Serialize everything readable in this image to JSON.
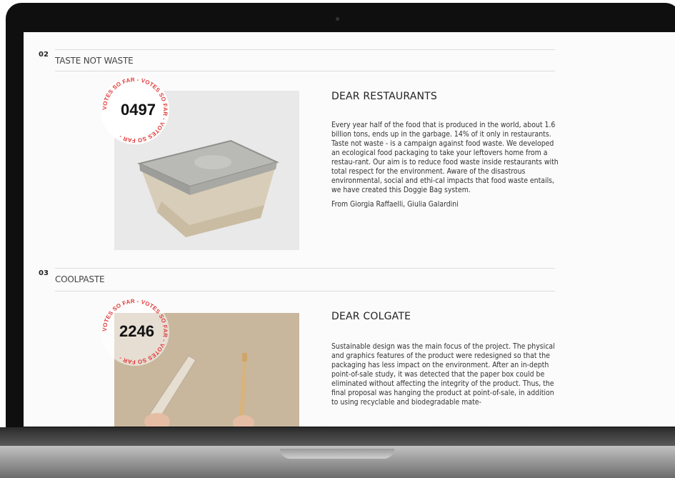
{
  "entries": [
    {
      "number": "02",
      "title": "TASTE NOT WASTE",
      "votes": "0497",
      "badge_text": "VOTES SO FAR - VOTES SO FAR - VOTES SO FAR - ",
      "heading": "DEAR RESTAURANTS",
      "paragraphs": [
        "Every year half of the food that is produced in the world, about 1.6 billion tons, ends up in the garbage. 14% of it only in restaurants. Taste not waste - is a campaign against food waste. We developed an ecological food packaging to take your leftovers home from a restau-rant. Our aim is to reduce food waste inside restaurants with total respect for the environment. Aware of the disastrous environmental, social and ethi-cal impacts that food waste entails, we have created this Doggie Bag system.",
        "From Giorgia Raffaelli, Giulia Galardini"
      ]
    },
    {
      "number": "03",
      "title": "COOLPASTE",
      "votes": "2246",
      "badge_text": "VOTES SO FAR - VOTES SO FAR - VOTES SO FAR - ",
      "heading": "DEAR COLGATE",
      "paragraphs": [
        "Sustainable design was the main focus of the project. The physical and graphics features of the product were redesigned so that the packaging has less impact on the environment. After an in-depth point-of-sale study, it was detected that the paper box could be eliminated without affecting the integrity of the product. Thus, the final proposal was hanging the product at point-of-sale, in addition to using recyclable and biodegradable mate-"
      ]
    }
  ],
  "colors": {
    "badge": "#e23a3a",
    "frame": "#0f0f0f",
    "screen": "#fbfbfb"
  }
}
